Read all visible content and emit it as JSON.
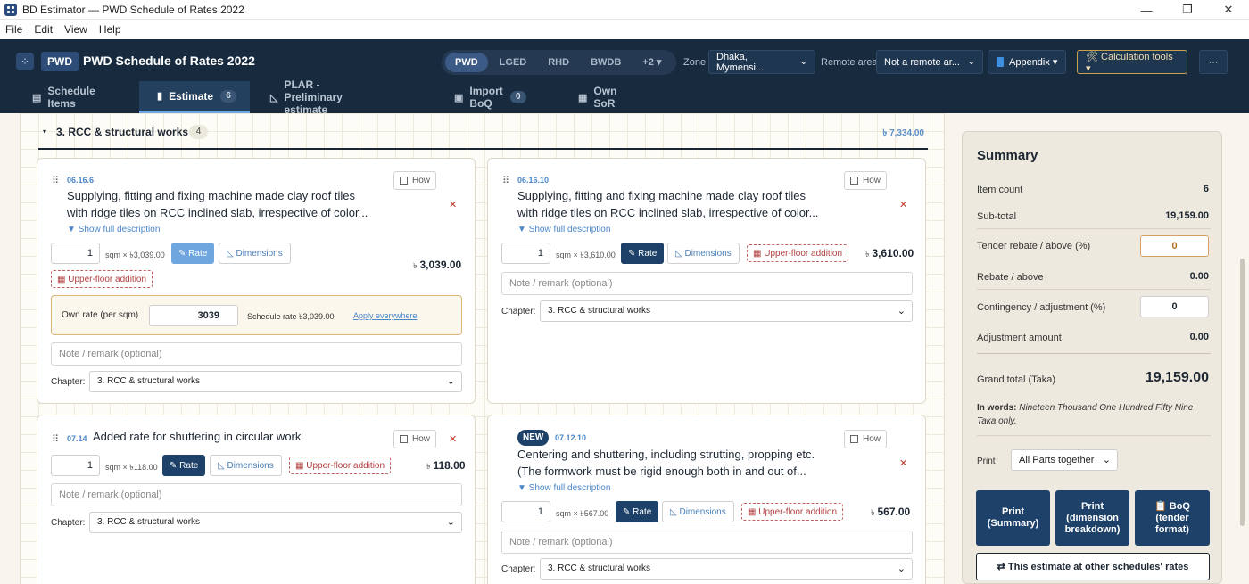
{
  "window": {
    "title": "BD Estimator — PWD Schedule of Rates 2022",
    "minimize": "—",
    "maximize": "❐",
    "close": "✕"
  },
  "menu": [
    "File",
    "Edit",
    "View",
    "Help"
  ],
  "header": {
    "badge": "PWD",
    "title": "PWD Schedule of Rates 2022",
    "schedules": [
      "PWD",
      "LGED",
      "RHD",
      "BWDB",
      "+2 ▾"
    ],
    "active_schedule": "PWD",
    "zone_label": "Zone",
    "zone_value": "Dhaka, Mymensi...",
    "remote_label": "Remote area",
    "remote_value": "Not a remote ar...",
    "appendix_label": "Appendix ▾",
    "calc_label": "🛠 Calculation tools ▾",
    "more_label": "⋯"
  },
  "tabs": [
    {
      "label": "Schedule Items",
      "icon": "▤"
    },
    {
      "label": "Estimate",
      "icon": "▮",
      "count": "6"
    },
    {
      "label": "PLAR - Preliminary estimate",
      "icon": "◺"
    },
    {
      "label": "Import BoQ",
      "icon": "▣",
      "count": "0"
    },
    {
      "label": "Own SoR",
      "icon": "▦"
    }
  ],
  "chapter": {
    "toggle": "▾",
    "title": "3. RCC & structural works",
    "count": "4",
    "total": "৳ 7,334.00"
  },
  "common": {
    "drag": "⠿",
    "how": "How",
    "remove": "✕",
    "show_full": "▼ Show full description",
    "rate_label": "✎ Rate",
    "dimensions_label": "◺ Dimensions",
    "upper_floor_label": "▦ Upper-floor addition",
    "note_placeholder": "Note / remark (optional)",
    "chapter_label": "Chapter:",
    "chapter_value": "3. RCC & structural works",
    "chev": "⌄",
    "taka": "৳"
  },
  "items": [
    {
      "code": "06.16.6",
      "desc_line1": "Supplying, fitting and fixing machine made clay roof tiles",
      "desc_line2": "with ridge tiles on RCC inclined slab, irrespective of color...",
      "qty": "1",
      "unit": "sqm × ৳3,039.00",
      "amount": "3,039.00",
      "own_rate_label": "Own rate (per sqm)",
      "own_rate_value": "3039",
      "schedule_rate": "Schedule rate ৳3,039.00",
      "apply_everywhere": "Apply everywhere"
    },
    {
      "code": "06.16.10",
      "desc_line1": "Supplying, fitting and fixing machine made clay roof tiles",
      "desc_line2": "with ridge tiles on RCC inclined slab, irrespective of color...",
      "qty": "1",
      "unit": "sqm × ৳3,610.00",
      "amount": "3,610.00"
    },
    {
      "code": "07.14",
      "desc_line1": "Added rate for shuttering in circular work",
      "qty": "1",
      "unit": "sqm × ৳118.00",
      "amount": "118.00"
    },
    {
      "badge": "NEW",
      "code": "07.12.10",
      "desc_line1": "Centering and shuttering, including strutting, propping etc.",
      "desc_line2": "(The formwork must be rigid enough both in and out of...",
      "qty": "1",
      "unit": "sqm × ৳567.00",
      "amount": "567.00"
    }
  ],
  "summary": {
    "title": "Summary",
    "item_count_label": "Item count",
    "item_count": "6",
    "subtotal_label": "Sub-total",
    "subtotal": "19,159.00",
    "rebate_pct_label": "Tender rebate / above (%)",
    "rebate_pct": "0",
    "rebate_label": "Rebate / above",
    "rebate": "0.00",
    "contingency_label": "Contingency / adjustment (%)",
    "contingency": "0",
    "adjustment_label": "Adjustment amount",
    "adjustment": "0.00",
    "grand_label": "Grand total (Taka)",
    "grand": "19,159.00",
    "words_label": "In words:",
    "words": "Nineteen Thousand One Hundred Fifty Nine Taka only.",
    "print_label": "Print",
    "print_value": "All Parts together",
    "print_summary": "Print (Summary)",
    "print_dimension": "Print (dimension breakdown)",
    "boq_tender": "📋 BoQ (tender format)",
    "other_schedules": "⇄ This estimate at other schedules' rates"
  }
}
